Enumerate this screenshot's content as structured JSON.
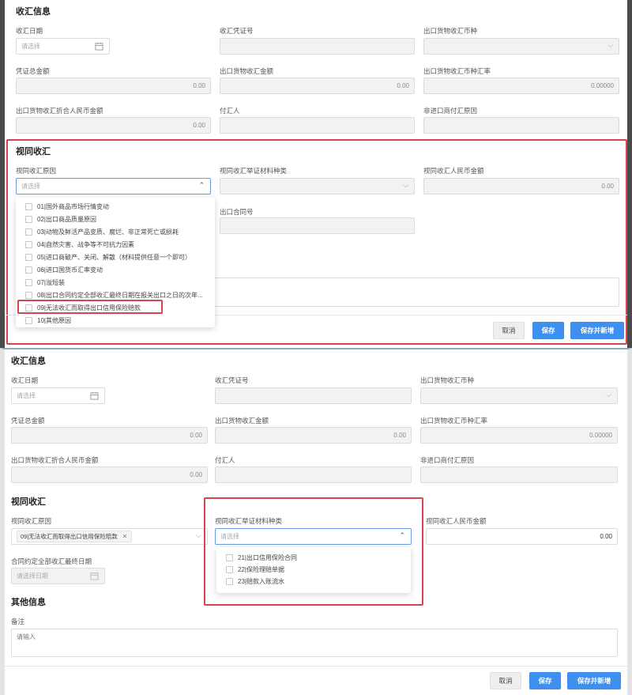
{
  "labels": {
    "section_receipt": "收汇信息",
    "receipt_date": "收汇日期",
    "receipt_voucher_no": "收汇凭证号",
    "export_currency": "出口货物收汇币种",
    "voucher_total": "凭证总金额",
    "export_amount": "出口货物收汇金额",
    "export_rate": "出口货物收汇币种汇率",
    "export_rmb": "出口货物收汇折合人民币金额",
    "payer": "付汇人",
    "non_import_reason": "非进口商付汇原因",
    "section_deemed": "视同收汇",
    "deemed_reason": "视同收汇原因",
    "deemed_proof_type": "视同收汇举证材料种类",
    "deemed_rmb": "视同收汇人民币金额",
    "contract_no": "出口合同号",
    "contract_deadline": "合同约定全部收汇最终日期",
    "section_other": "其他信息",
    "remark": "备注"
  },
  "placeholders": {
    "select": "请选择",
    "select_date": "请选择日期",
    "input": "请输入"
  },
  "values": {
    "zero": "0.00",
    "rate_zero": "0.00000"
  },
  "reason_options": [
    "01|国外商品市场行情变动",
    "02|出口商品质量原因",
    "03|动物及鲜活产品变质、腐烂、非正常死亡或损耗",
    "04|自然灾害、战争等不可抗力因素",
    "05|进口商破产、关闭、解散（材料提供任意一个即可）",
    "06|进口国货币汇率变动",
    "07|溢短装",
    "08|出口合同约定全部收汇最终日期在报关出口之日的次年...",
    "09|无法收汇而取得出口信用保险赔款",
    "10|其他原因"
  ],
  "selected_reason": "09|无法收汇而取得出口信用保险赔款",
  "proof_options": [
    "21|出口信用保险合同",
    "22|保险理赔单据",
    "23|赔款入账流水"
  ],
  "buttons": {
    "cancel": "取消",
    "save": "保存",
    "save_new": "保存并新增"
  },
  "colors": {
    "primary": "#3d8ff0",
    "highlight": "#d6454e"
  }
}
